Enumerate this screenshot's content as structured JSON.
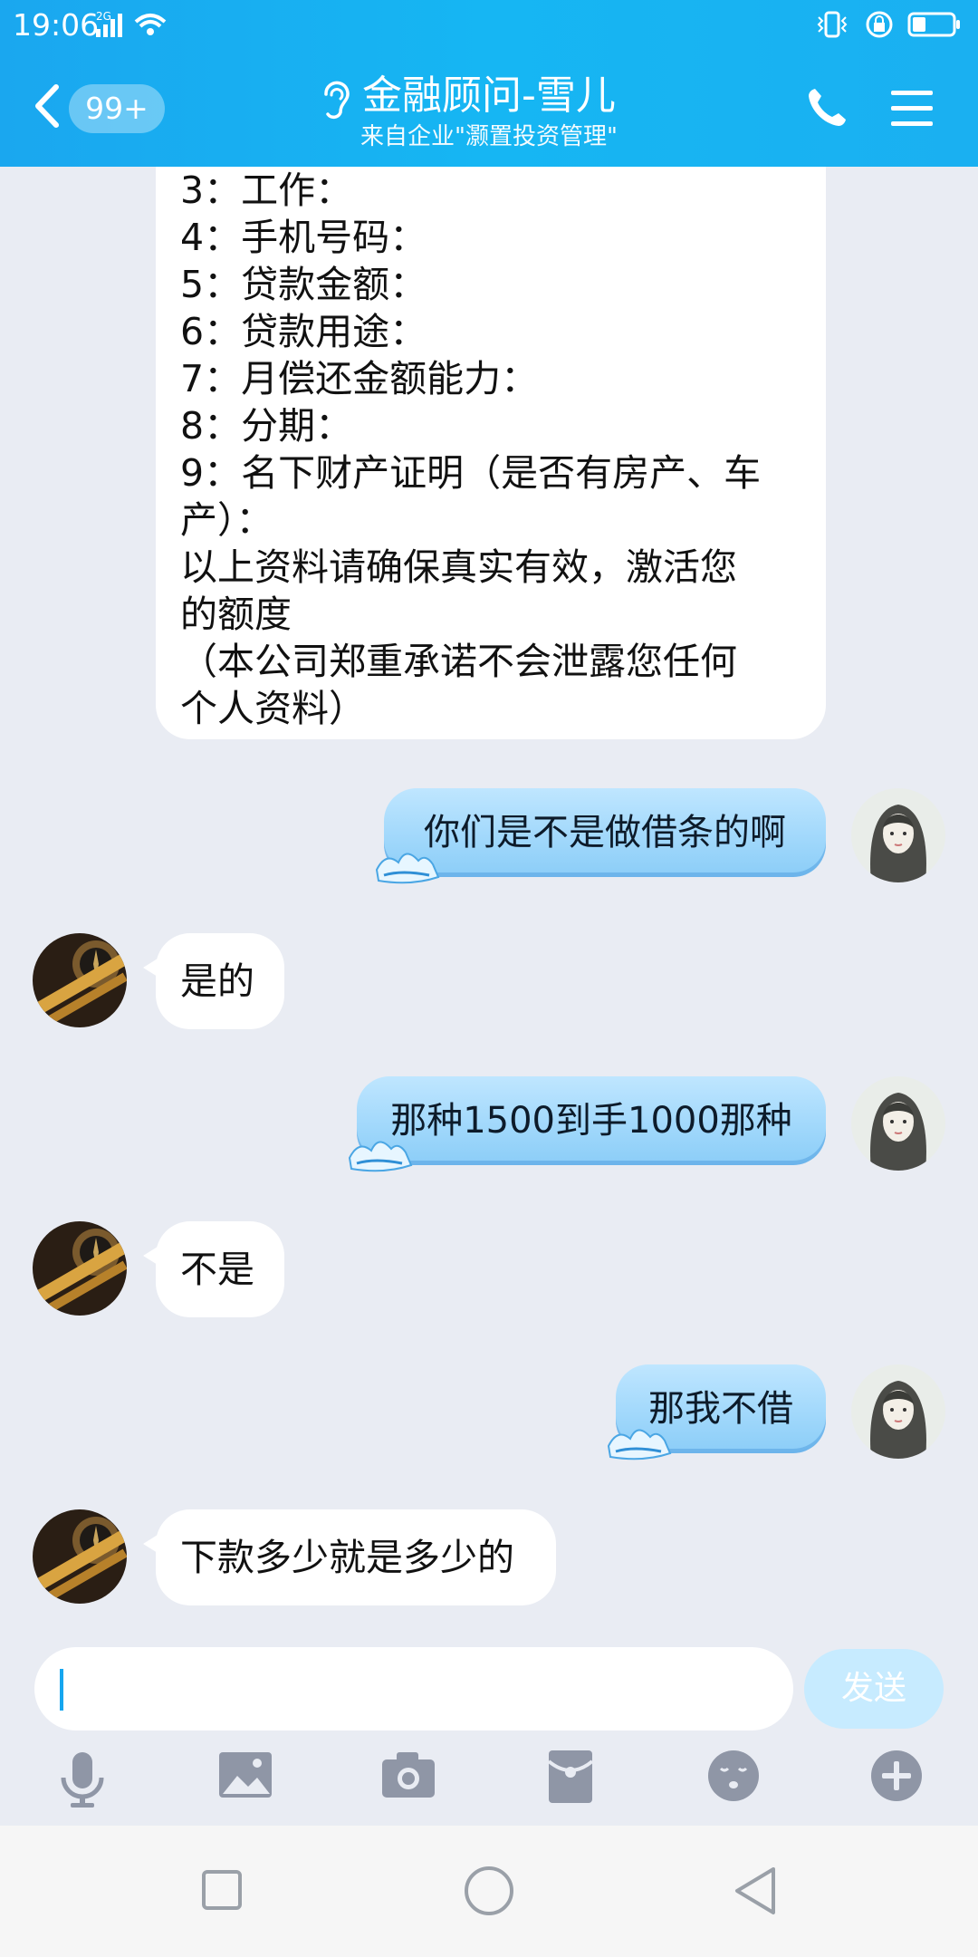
{
  "status": {
    "time": "19:06",
    "network": "2G"
  },
  "header": {
    "badge": "99+",
    "title": "金融顾问-雪儿",
    "subtitle": "来自企业\"灏置投资管理\""
  },
  "messages": {
    "form_lines": [
      "3：工作：",
      "4：手机号码：",
      "5：贷款金额：",
      "6：贷款用途：",
      "7：月偿还金额能力：",
      "8：分期：",
      "9：名下财产证明（是否有房产、车",
      "产）：",
      "以上资料请确保真实有效，激活您",
      "的额度",
      "（本公司郑重承诺不会泄露您任何",
      "个人资料）"
    ],
    "m1": "你们是不是做借条的啊",
    "m2": "是的",
    "m3": "那种1500到手1000那种",
    "m4": "不是",
    "m5": "那我不借",
    "m6": "下款多少就是多少的"
  },
  "input": {
    "value": "",
    "send_label": "发送"
  },
  "icons": {
    "back": "chevron-left-icon",
    "ear": "ear-icon",
    "phone": "phone-icon",
    "menu": "menu-icon",
    "toolbar": [
      "microphone-icon",
      "image-icon",
      "camera-icon",
      "red-packet-icon",
      "emoji-icon",
      "plus-icon"
    ]
  },
  "colors": {
    "header": "#16b6f3",
    "background": "#e9ecf3",
    "bubble_right": "#a9dcfb"
  }
}
